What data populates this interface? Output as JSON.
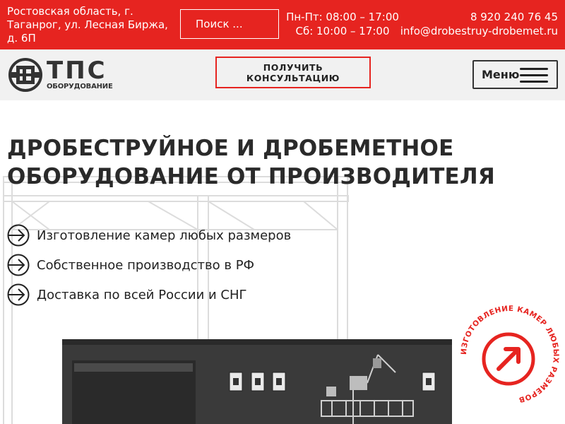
{
  "topbar": {
    "address": "Ростовская область, г. Таганрог, ул. Лесная Биржа, д. 6П",
    "search_label": "Поиск ...",
    "hours_weekdays": "Пн-Пт: 08:00 – 17:00",
    "hours_saturday": "Сб: 10:00 – 17:00",
    "phone": "8 920 240 76 45",
    "email": "info@drobestruy-drobemet.ru"
  },
  "header": {
    "logo_main": "ТПС",
    "logo_sub": "ОБОРУДОВАНИЕ",
    "consult_button": "ПОЛУЧИТЬ КОНСУЛЬТАЦИЮ",
    "menu_label": "Меню"
  },
  "hero": {
    "title_line1": "ДРОБЕСТРУЙНОЕ И ДРОБЕМЕТНОЕ",
    "title_line2": "ОБОРУДОВАНИЕ ОТ ПРОИЗВОДИТЕЛЯ",
    "features": [
      "Изготовление камер любых размеров",
      "Собственное производство в РФ",
      "Доставка по всей России и СНГ"
    ],
    "badge_text": "ИЗГОТОВЛЕНИЕ КАМЕР ЛЮБЫХ РАЗМЕРОВ"
  },
  "colors": {
    "brand_red": "#e62420",
    "header_bg": "#f1f1f1",
    "text_dark": "#2a2a2a"
  },
  "icons": [
    "arrow-right-circle-icon",
    "hamburger-icon",
    "logo-mark-icon",
    "arrow-up-right-icon"
  ]
}
